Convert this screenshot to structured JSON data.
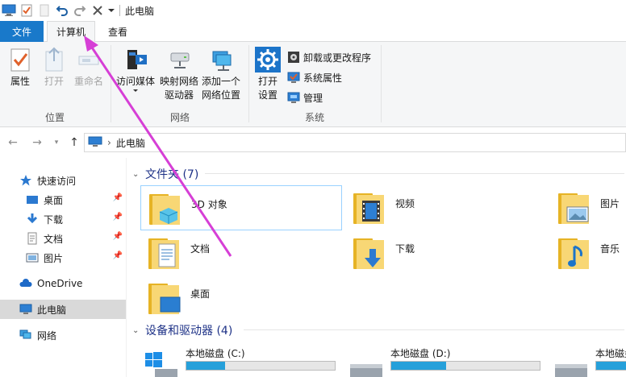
{
  "window": {
    "title": "此电脑"
  },
  "tabs": {
    "file": "文件",
    "computer": "计算机",
    "view": "查看"
  },
  "ribbon": {
    "location": {
      "label": "位置",
      "properties": "属性",
      "open": "打开",
      "rename": "重命名"
    },
    "network": {
      "label": "网络",
      "access_media": "访问媒体",
      "map_drive_line1": "映射网络",
      "map_drive_line2": "驱动器",
      "add_location_line1": "添加一个",
      "add_location_line2": "网络位置"
    },
    "system": {
      "label": "系统",
      "open_settings_line1": "打开",
      "open_settings_line2": "设置",
      "uninstall": "卸载或更改程序",
      "system_properties": "系统属性",
      "manage": "管理"
    }
  },
  "address": {
    "crumb": "此电脑"
  },
  "navpane": {
    "quick_access": "快速访问",
    "desktop": "桌面",
    "downloads": "下载",
    "documents": "文档",
    "pictures": "图片",
    "onedrive": "OneDrive",
    "this_pc": "此电脑",
    "network": "网络"
  },
  "content": {
    "folders_header": "文件夹 (7)",
    "folders": {
      "objects3d": "3D 对象",
      "videos": "视频",
      "pictures": "图片",
      "documents": "文档",
      "downloads": "下载",
      "music": "音乐",
      "desktop": "桌面"
    },
    "devices_header": "设备和驱动器 (4)",
    "drives": [
      {
        "label": "本地磁盘 (C:)",
        "used_fraction": 0.26
      },
      {
        "label": "本地磁盘 (D:)",
        "used_fraction": 0.37
      },
      {
        "label": "本地磁盘",
        "used_fraction": 0.3
      }
    ]
  },
  "colors": {
    "accent": "#1979ca",
    "annotation_arrow": "#d63fd6",
    "drive_fill": "#26a0da"
  }
}
